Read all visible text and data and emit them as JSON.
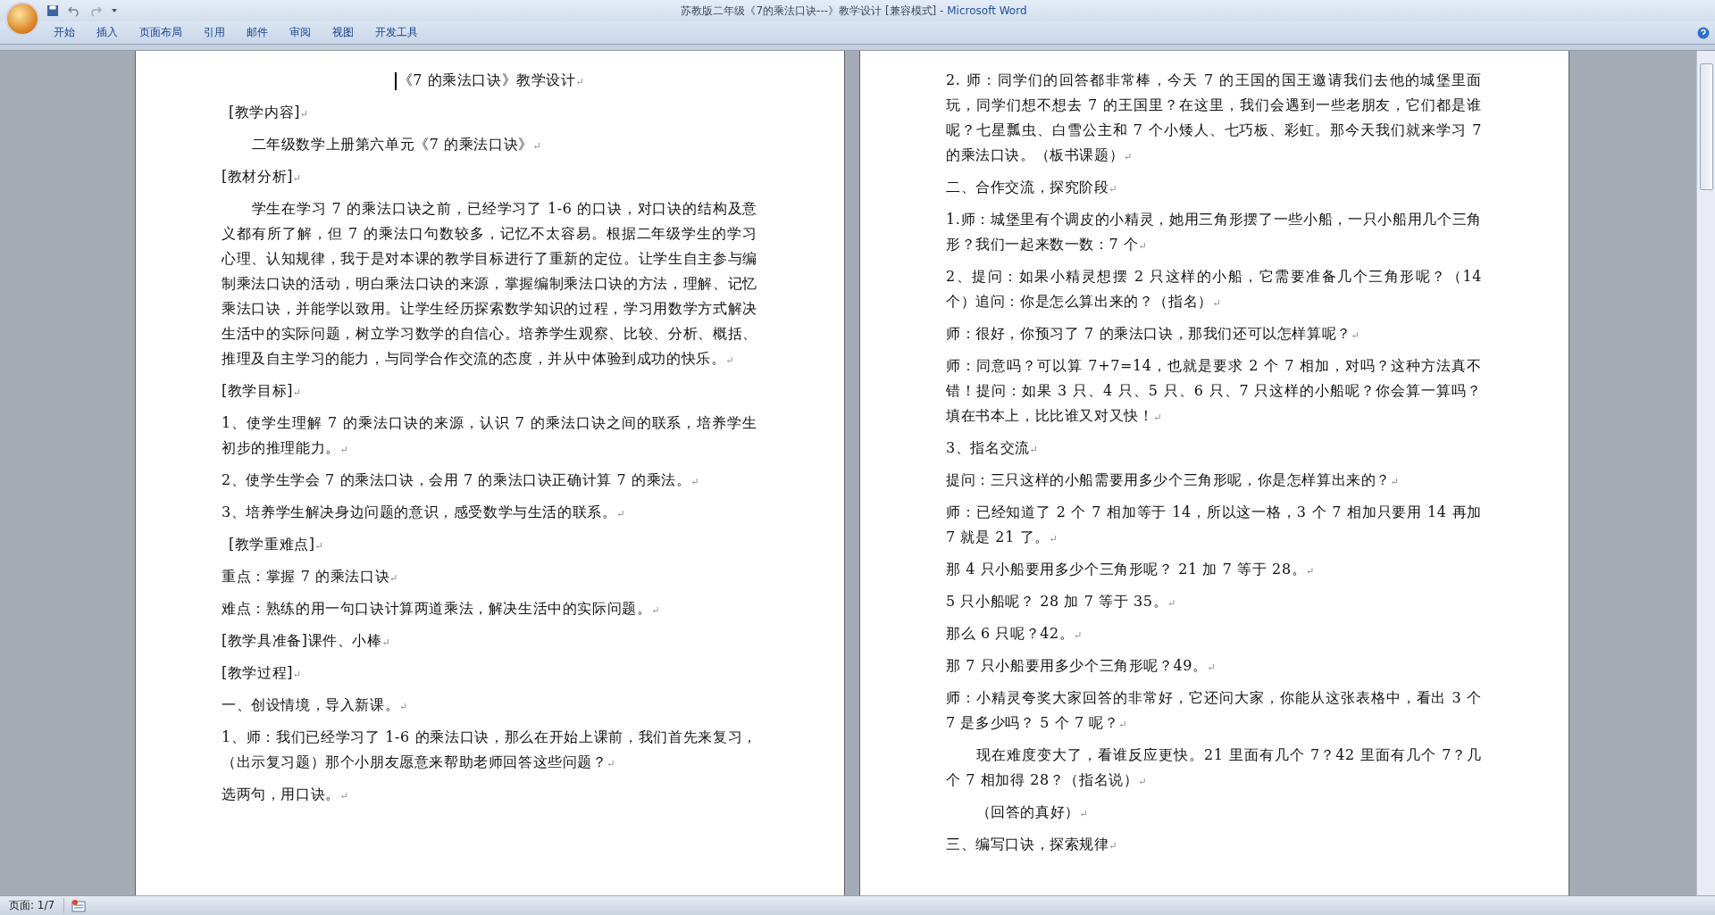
{
  "window": {
    "document_title": "苏教版二年级《7的乘法口诀---》教学设计 [兼容模式]",
    "separator": " - ",
    "app_name": "Microsoft Word"
  },
  "ribbon_tabs": [
    {
      "label": "开始"
    },
    {
      "label": "插入"
    },
    {
      "label": "页面布局"
    },
    {
      "label": "引用"
    },
    {
      "label": "邮件"
    },
    {
      "label": "审阅"
    },
    {
      "label": "视图"
    },
    {
      "label": "开发工具"
    }
  ],
  "paragraph_mark": "↵",
  "pages": [
    {
      "paragraphs": [
        {
          "kind": "title",
          "text": "《7 的乘法口诀》教学设计"
        },
        {
          "kind": "nudge",
          "text": "[教学内容]"
        },
        {
          "kind": "indent",
          "text": "二年级数学上册第六单元《7 的乘法口诀》"
        },
        {
          "kind": "plain",
          "text": "[教材分析]"
        },
        {
          "kind": "indent",
          "text": "学生在学习 7 的乘法口诀之前，已经学习了 1-6 的口诀，对口诀的结构及意义都有所了解，但 7 的乘法口句数较多，记忆不太容易。根据二年级学生的学习心理、认知规律，我于是对本课的教学目标进行了重新的定位。让学生自主参与编制乘法口诀的活动，明白乘法口诀的来源，掌握编制乘法口诀的方法，理解、记忆乘法口诀，并能学以致用。让学生经历探索数学知识的过程，学习用数学方式解决生活中的实际问题，树立学习数学的自信心。培养学生观察、比较、分析、概括、推理及自主学习的能力，与同学合作交流的态度，并从中体验到成功的快乐。"
        },
        {
          "kind": "plain",
          "text": "[教学目标]"
        },
        {
          "kind": "plain",
          "text": "1、使学生理解 7 的乘法口诀的来源，认识 7 的乘法口诀之间的联系，培养学生初步的推理能力。"
        },
        {
          "kind": "plain",
          "text": "2、使学生学会 7 的乘法口诀，会用 7 的乘法口诀正确计算 7 的乘法。"
        },
        {
          "kind": "plain",
          "text": "3、培养学生解决身边问题的意识，感受数学与生活的联系。"
        },
        {
          "kind": "nudge",
          "text": "[教学重难点]"
        },
        {
          "kind": "plain",
          "text": "重点：掌握 7 的乘法口诀"
        },
        {
          "kind": "plain",
          "text": "难点：熟练的用一句口诀计算两道乘法，解决生活中的实际问题。"
        },
        {
          "kind": "plain",
          "text": "[教学具准备]课件、小棒"
        },
        {
          "kind": "plain",
          "text": "[教学过程]"
        },
        {
          "kind": "plain",
          "text": "一、创设情境，导入新课。"
        },
        {
          "kind": "plain",
          "text": "1、师：我们已经学习了 1-6 的乘法口诀，那么在开始上课前，我们首先来复习，（出示复习题）那个小朋友愿意来帮助老师回答这些问题？"
        },
        {
          "kind": "plain",
          "text": "选两句，用口诀。"
        }
      ]
    },
    {
      "paragraphs": [
        {
          "kind": "plain",
          "text": "2. 师：同学们的回答都非常棒，今天 7 的王国的国王邀请我们去他的城堡里面玩，同学们想不想去 7 的王国里？在这里，我们会遇到一些老朋友，它们都是谁呢？七星瓢虫、白雪公主和 7 个小矮人、七巧板、彩虹。那今天我们就来学习 7 的乘法口诀。（板书课题）"
        },
        {
          "kind": "plain",
          "text": "二、合作交流，探究阶段"
        },
        {
          "kind": "plain",
          "text": "1.师：城堡里有个调皮的小精灵，她用三角形摆了一些小船，一只小船用几个三角形？我们一起来数一数：7 个"
        },
        {
          "kind": "plain",
          "text": "2、提问：如果小精灵想摆 2 只这样的小船，它需要准备几个三角形呢？（14 个）追问：你是怎么算出来的？（指名）"
        },
        {
          "kind": "plain",
          "text": "师：很好，你预习了 7 的乘法口诀，那我们还可以怎样算呢？"
        },
        {
          "kind": "plain",
          "text": "师：同意吗？可以算 7+7=14，也就是要求 2 个 7 相加，对吗？这种方法真不错！提问：如果 3 只、4 只、5 只、6 只、7 只这样的小船呢？你会算一算吗？填在书本上，比比谁又对又快！"
        },
        {
          "kind": "plain",
          "text": "3、指名交流"
        },
        {
          "kind": "plain",
          "text": "提问：三只这样的小船需要用多少个三角形呢，你是怎样算出来的？"
        },
        {
          "kind": "plain",
          "text": "师：已经知道了 2 个 7 相加等于 14，所以这一格，3 个 7 相加只要用 14 再加 7 就是 21 了。"
        },
        {
          "kind": "plain",
          "text": "那 4 只小船要用多少个三角形呢？ 21 加 7 等于 28。"
        },
        {
          "kind": "plain",
          "text": "5 只小船呢？ 28 加 7 等于 35。"
        },
        {
          "kind": "plain",
          "text": "那么 6 只呢？42。"
        },
        {
          "kind": "plain",
          "text": "那 7 只小船要用多少个三角形呢？49。"
        },
        {
          "kind": "plain",
          "text": "师：小精灵夸奖大家回答的非常好，它还问大家，你能从这张表格中，看出 3 个 7 是多少吗？ 5 个 7 呢？"
        },
        {
          "kind": "indent",
          "text": "现在难度变大了，看谁反应更快。21 里面有几个 7？42 里面有几个 7？几个 7 相加得 28？（指名说）"
        },
        {
          "kind": "indent",
          "text": "（回答的真好）"
        },
        {
          "kind": "plain",
          "text": "三、编写口诀，探索规律"
        }
      ]
    }
  ],
  "status_bar": {
    "page": "页面: 1/7"
  }
}
